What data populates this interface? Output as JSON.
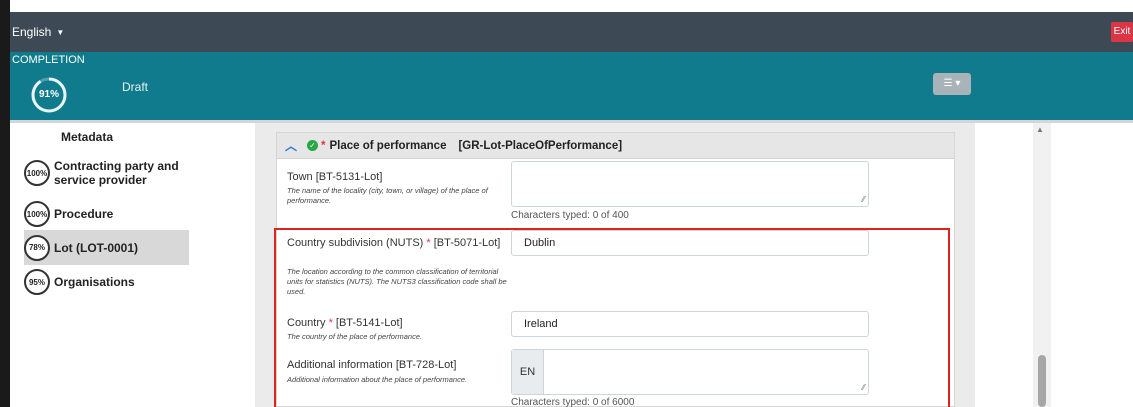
{
  "topbar": {
    "language": "English",
    "exit_label": "Exit"
  },
  "completion": {
    "label": "COMPLETION",
    "percent": "91%",
    "percent_value": 0.91,
    "status": "Draft"
  },
  "sidebar": {
    "title": "Metadata",
    "items": [
      {
        "pct": "100%",
        "label": "Contracting party and service provider",
        "active": false
      },
      {
        "pct": "100%",
        "label": "Procedure",
        "active": false
      },
      {
        "pct": "78%",
        "label": "Lot (LOT-0001)",
        "active": true
      },
      {
        "pct": "95%",
        "label": "Organisations",
        "active": false
      }
    ]
  },
  "section": {
    "required_mark": "*",
    "title": "Place of performance",
    "identifier": "[GR-Lot-PlaceOfPerformance]"
  },
  "fields": {
    "town": {
      "label": "Town [BT-5131-Lot]",
      "desc": "The name of the locality (city, town, or village) of the place of performance.",
      "counter": "Characters typed: 0 of 400"
    },
    "nuts": {
      "label_a": "Country subdivision (NUTS) ",
      "star": "*",
      "label_b": " [BT-5071-Lot]",
      "desc": "The location according to the common classification of territorial units for statistics (NUTS). The NUTS3 classification code shall be used.",
      "value": "Dublin"
    },
    "country": {
      "label_a": "Country ",
      "star": "*",
      "label_b": " [BT-5141-Lot]",
      "desc": "The country of the place of performance.",
      "value": "Ireland"
    },
    "additional": {
      "label": "Additional information [BT-728-Lot]",
      "desc": "Additional information about the place of performance.",
      "lang": "EN",
      "counter": "Characters typed: 0 of 6000"
    }
  },
  "colors": {
    "topbar": "#3d4a55",
    "completion": "#0f7b8c",
    "highlight": "#d9251d",
    "exit": "#dc3545"
  }
}
